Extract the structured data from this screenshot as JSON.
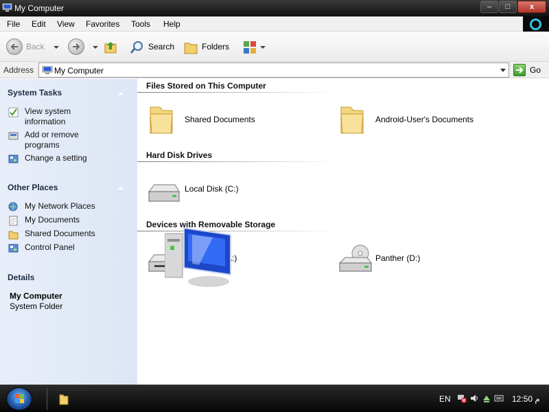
{
  "window": {
    "title": "My Computer",
    "minimize_glyph": "‒",
    "maximize_glyph": "□",
    "close_glyph": "x"
  },
  "menu": [
    "File",
    "Edit",
    "View",
    "Favorites",
    "Tools",
    "Help"
  ],
  "toolbar": {
    "back_label": "Back",
    "search_label": "Search",
    "folders_label": "Folders"
  },
  "address": {
    "label": "Address",
    "value": "My Computer",
    "go_label": "Go"
  },
  "taskpane": {
    "system_tasks": {
      "header": "System Tasks",
      "items": [
        {
          "label": "View system information",
          "icon": "system-info-icon"
        },
        {
          "label": "Add or remove programs",
          "icon": "add-remove-programs-icon"
        },
        {
          "label": "Change a setting",
          "icon": "control-panel-icon"
        }
      ]
    },
    "other_places": {
      "header": "Other Places",
      "items": [
        {
          "label": "My Network Places",
          "icon": "network-places-icon"
        },
        {
          "label": "My Documents",
          "icon": "documents-icon"
        },
        {
          "label": "Shared Documents",
          "icon": "folder-icon"
        },
        {
          "label": "Control Panel",
          "icon": "control-panel-icon"
        }
      ]
    },
    "details": {
      "header": "Details",
      "title": "My Computer",
      "subtitle": "System Folder"
    }
  },
  "content": {
    "groups": [
      {
        "header": "Files Stored on This Computer",
        "items": [
          "Shared Documents",
          "Android-User's Documents"
        ]
      },
      {
        "header": "Hard Disk Drives",
        "items": [
          "Local Disk (C:)"
        ]
      },
      {
        "header": "Devices with Removable Storage",
        "items": [
          "A:)",
          "Panther  (D:)"
        ]
      }
    ]
  },
  "taskbar": {
    "language": "EN",
    "time": "12:50 م"
  },
  "colors": {
    "title_bar": "#1a1a1a",
    "task_pane": "#e3eaf7",
    "tray_accent": "#38c5e6"
  }
}
